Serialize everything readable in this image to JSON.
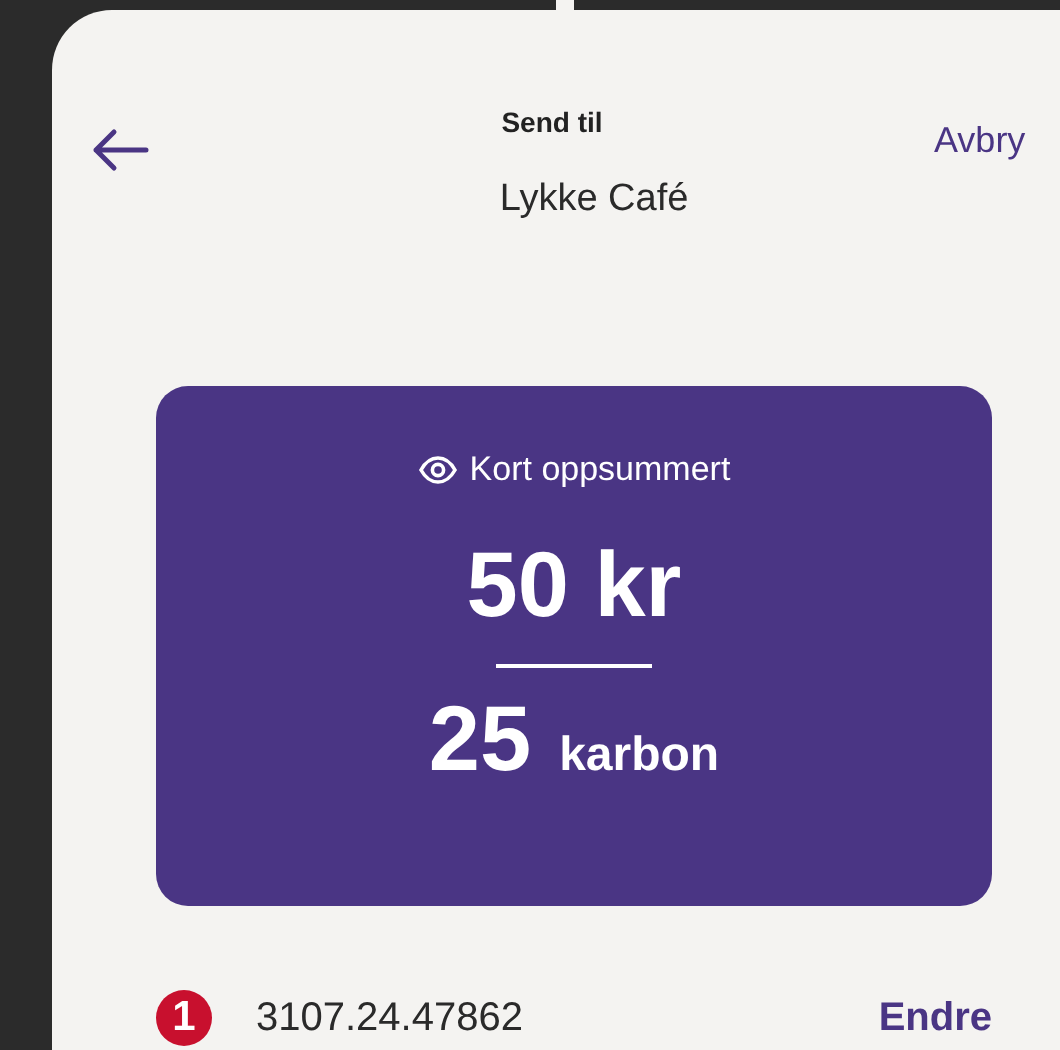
{
  "header": {
    "title": "Send til",
    "recipient": "Lykke Café",
    "cancel": "Avbry"
  },
  "summary": {
    "label": "Kort oppsummert",
    "amount": "50 kr",
    "points_value": "25",
    "points_unit": "karbon"
  },
  "account": {
    "bank_logo": "1",
    "number": "3107.24.47862",
    "action": "Endre"
  }
}
